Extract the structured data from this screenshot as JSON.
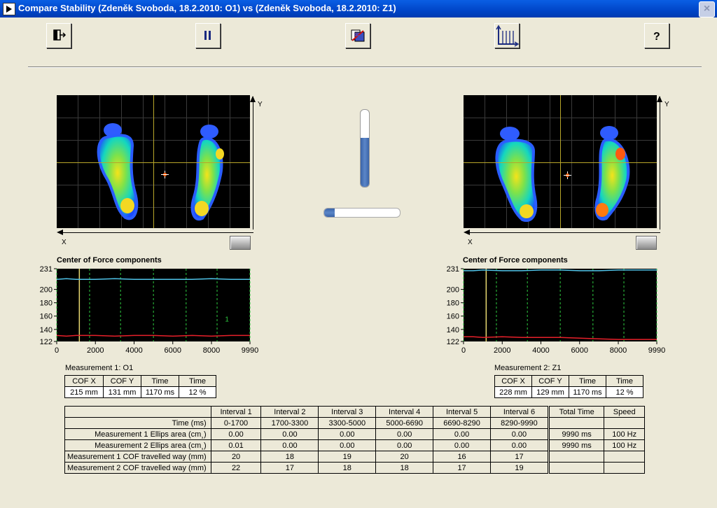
{
  "window": {
    "title": "Compare Stability (Zdeněk Svoboda, 18.2.2010: O1) vs (Zdeněk Svoboda, 18.2.2010: Z1)",
    "close": "×"
  },
  "toolbar": {
    "buttons": [
      {
        "name": "exit-icon"
      },
      {
        "name": "pause-icon"
      },
      {
        "name": "compare-icon"
      },
      {
        "name": "graph-axes-icon"
      },
      {
        "name": "help-icon"
      }
    ]
  },
  "pressure_left": {
    "x_label": "X",
    "y_label": "Y"
  },
  "pressure_right": {
    "x_label": "X",
    "y_label": "Y"
  },
  "sliders": {
    "vertical_level_percent": 64,
    "horizontal_level_percent": 14
  },
  "colors": {
    "chart_bg": "#000000",
    "series_cop_x": "#4FC3E8",
    "series_cop_y": "#E8202A",
    "cursor": "#E8D870",
    "interval_marker": "#2ECC40",
    "window_title": "#0054E3"
  },
  "charts": {
    "left": {
      "title": "Center of Force components",
      "marker_label": "1"
    },
    "right": {
      "title": "Center of Force components"
    }
  },
  "chart_data": [
    {
      "type": "line",
      "title": "Center of Force components",
      "y_ticks": [
        231,
        200,
        180,
        160,
        140,
        122
      ],
      "x_ticks": [
        0,
        2000,
        4000,
        6000,
        8000,
        9990
      ],
      "ylim": [
        122,
        231
      ],
      "xlim": [
        0,
        9990
      ],
      "cursor_x": 1170,
      "interval_markers": [
        0,
        1700,
        3300,
        5000,
        6690,
        8290,
        9990
      ],
      "annotation": {
        "text": "1",
        "x": 8800,
        "y": 152
      },
      "series": [
        {
          "color": "#4FC3E8",
          "x": [
            0,
            500,
            1000,
            2000,
            3000,
            4000,
            5000,
            6000,
            7000,
            8000,
            9000,
            9990
          ],
          "values": [
            215,
            216,
            215,
            215,
            216,
            215,
            215,
            215,
            215,
            216,
            215,
            215
          ]
        },
        {
          "color": "#E8202A",
          "x": [
            0,
            500,
            1000,
            2000,
            3000,
            4000,
            5000,
            6000,
            7000,
            8000,
            9000,
            9990
          ],
          "values": [
            131,
            130,
            131,
            131,
            130,
            131,
            131,
            130,
            131,
            130,
            131,
            131
          ]
        }
      ]
    },
    {
      "type": "line",
      "title": "Center of Force components",
      "y_ticks": [
        231,
        200,
        180,
        160,
        140,
        122
      ],
      "x_ticks": [
        0,
        2000,
        4000,
        6000,
        8000,
        9990
      ],
      "ylim": [
        122,
        231
      ],
      "xlim": [
        0,
        9990
      ],
      "cursor_x": 1170,
      "interval_markers": [
        0,
        1700,
        3300,
        5000,
        6690,
        8290,
        9990
      ],
      "series": [
        {
          "color": "#4FC3E8",
          "x": [
            0,
            500,
            1000,
            2000,
            3000,
            4000,
            5000,
            6000,
            7000,
            8000,
            9000,
            9990
          ],
          "values": [
            228,
            228,
            229,
            228,
            228,
            229,
            229,
            228,
            228,
            229,
            229,
            229
          ]
        },
        {
          "color": "#E8202A",
          "x": [
            0,
            500,
            1000,
            2000,
            3000,
            4000,
            5000,
            6000,
            7000,
            8000,
            9000,
            9990
          ],
          "values": [
            129,
            129,
            128,
            129,
            128,
            128,
            128,
            127,
            126,
            125,
            125,
            125
          ]
        }
      ]
    }
  ],
  "measurement1": {
    "label": "Measurement 1: O1",
    "headers": [
      "COF X",
      "COF Y",
      "Time",
      "Time"
    ],
    "values": [
      "215 mm",
      "131 mm",
      "1170 ms",
      "12 %"
    ]
  },
  "measurement2": {
    "label": "Measurement 2: Z1",
    "headers": [
      "COF X",
      "COF Y",
      "Time",
      "Time"
    ],
    "values": [
      "228 mm",
      "129 mm",
      "1170 ms",
      "12 %"
    ]
  },
  "summary": {
    "headers": [
      "Interval 1",
      "Interval 2",
      "Interval 3",
      "Interval 4",
      "Interval 5",
      "Interval 6",
      "Total Time",
      "Speed"
    ],
    "rows": [
      {
        "label": "Time (ms)",
        "cells": [
          "0-1700",
          "1700-3300",
          "3300-5000",
          "5000-6690",
          "6690-8290",
          "8290-9990"
        ],
        "total": "",
        "speed": ""
      },
      {
        "label": "Measurement 1 Ellips area (cm¸)",
        "cells": [
          "0.00",
          "0.00",
          "0.00",
          "0.00",
          "0.00",
          "0.00"
        ],
        "total": "9990 ms",
        "speed": "100 Hz"
      },
      {
        "label": "Measurement 2 Ellips area (cm¸)",
        "cells": [
          "0.01",
          "0.00",
          "0.00",
          "0.00",
          "0.00",
          "0.00"
        ],
        "total": "9990 ms",
        "speed": "100 Hz"
      },
      {
        "label": "Measurement 1 COF travelled way (mm)",
        "cells": [
          "20",
          "18",
          "19",
          "20",
          "16",
          "17"
        ],
        "total": "",
        "speed": ""
      },
      {
        "label": "Measurement 2 COF travelled way (mm)",
        "cells": [
          "22",
          "17",
          "18",
          "18",
          "17",
          "19"
        ],
        "total": "",
        "speed": ""
      }
    ]
  }
}
